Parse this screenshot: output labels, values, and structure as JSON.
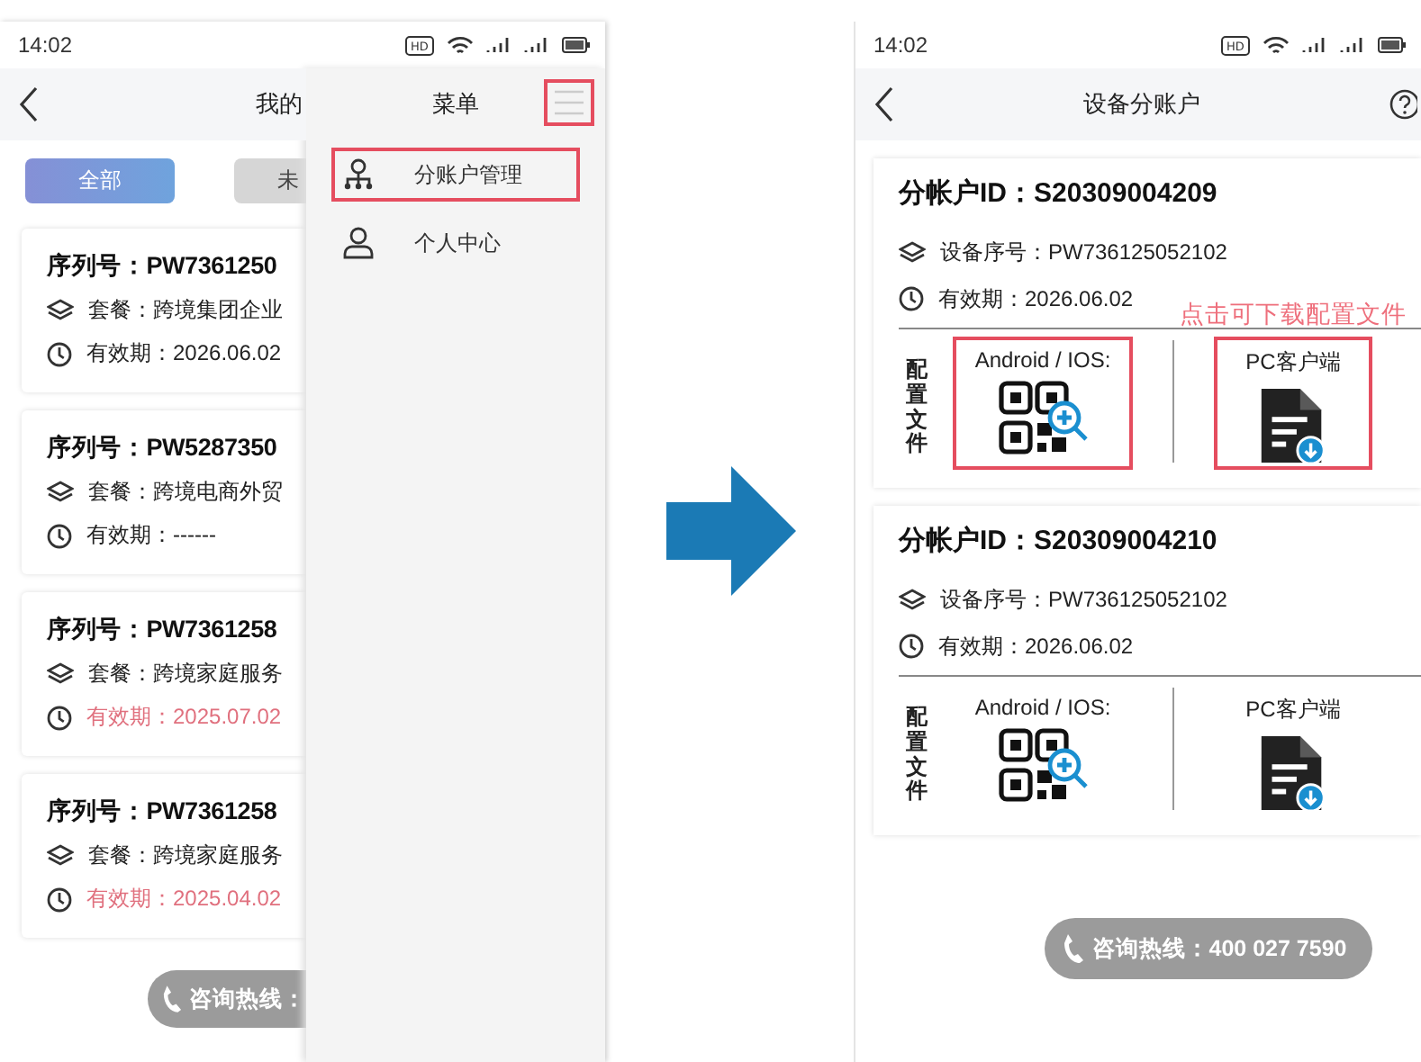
{
  "left_screen": {
    "status_bar": {
      "time": "14:02",
      "hd": "HD"
    },
    "header": {
      "title": "我的"
    },
    "filters": [
      {
        "label": "全部",
        "selected": true
      },
      {
        "label": "未",
        "selected": false
      }
    ],
    "devices": [
      {
        "serial": "序列号：PW7361250",
        "plan": "套餐：跨境集团企业",
        "expiry": "有效期：2026.06.02",
        "expired": false
      },
      {
        "serial": "序列号：PW5287350",
        "plan": "套餐：跨境电商外贸",
        "expiry": "有效期：------",
        "expired": false
      },
      {
        "serial": "序列号：PW7361258",
        "plan": "套餐：跨境家庭服务",
        "expiry": "有效期：2025.07.02",
        "expired": true
      },
      {
        "serial": "序列号：PW7361258",
        "plan": "套餐：跨境家庭服务",
        "expiry": "有效期：2025.04.02",
        "expired": true
      }
    ],
    "hotline": "咨询热线：",
    "menu": {
      "title": "菜单",
      "highlighted": true,
      "items": [
        {
          "kind": "accounts",
          "label": "分账户管理",
          "highlighted": true
        },
        {
          "kind": "person",
          "label": "个人中心",
          "highlighted": false
        }
      ]
    }
  },
  "right_screen": {
    "status_bar": {
      "time": "14:02",
      "hd": "HD"
    },
    "header": {
      "title": "设备分账户"
    },
    "accounts": [
      {
        "id": "分帐户ID：S20309004209",
        "serial": "设备序号：PW736125052102",
        "expiry": "有效期：2026.06.02",
        "note": "点击可下载配置文件",
        "config_label": "配置文件",
        "mobile_label": "Android / IOS:",
        "pc_label": "PC客户端",
        "highlighted": true
      },
      {
        "id": "分帐户ID：S20309004210",
        "serial": "设备序号：PW736125052102",
        "expiry": "有效期：2026.06.02",
        "config_label": "配置文件",
        "mobile_label": "Android / IOS:",
        "pc_label": "PC客户端",
        "highlighted": false
      }
    ],
    "hotline": "咨询热线：400 027 7590"
  }
}
